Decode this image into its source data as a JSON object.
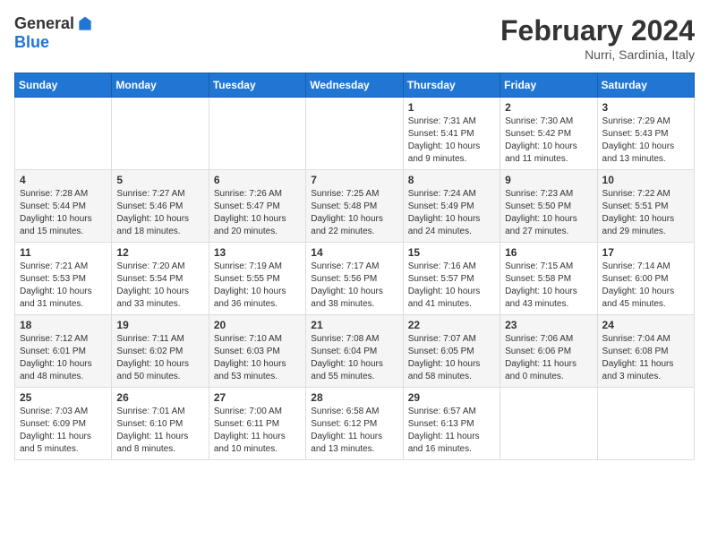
{
  "header": {
    "logo_general": "General",
    "logo_blue": "Blue",
    "month_year": "February 2024",
    "location": "Nurri, Sardinia, Italy"
  },
  "calendar": {
    "weekdays": [
      "Sunday",
      "Monday",
      "Tuesday",
      "Wednesday",
      "Thursday",
      "Friday",
      "Saturday"
    ],
    "weeks": [
      [
        {
          "day": "",
          "info": ""
        },
        {
          "day": "",
          "info": ""
        },
        {
          "day": "",
          "info": ""
        },
        {
          "day": "",
          "info": ""
        },
        {
          "day": "1",
          "info": "Sunrise: 7:31 AM\nSunset: 5:41 PM\nDaylight: 10 hours\nand 9 minutes."
        },
        {
          "day": "2",
          "info": "Sunrise: 7:30 AM\nSunset: 5:42 PM\nDaylight: 10 hours\nand 11 minutes."
        },
        {
          "day": "3",
          "info": "Sunrise: 7:29 AM\nSunset: 5:43 PM\nDaylight: 10 hours\nand 13 minutes."
        }
      ],
      [
        {
          "day": "4",
          "info": "Sunrise: 7:28 AM\nSunset: 5:44 PM\nDaylight: 10 hours\nand 15 minutes."
        },
        {
          "day": "5",
          "info": "Sunrise: 7:27 AM\nSunset: 5:46 PM\nDaylight: 10 hours\nand 18 minutes."
        },
        {
          "day": "6",
          "info": "Sunrise: 7:26 AM\nSunset: 5:47 PM\nDaylight: 10 hours\nand 20 minutes."
        },
        {
          "day": "7",
          "info": "Sunrise: 7:25 AM\nSunset: 5:48 PM\nDaylight: 10 hours\nand 22 minutes."
        },
        {
          "day": "8",
          "info": "Sunrise: 7:24 AM\nSunset: 5:49 PM\nDaylight: 10 hours\nand 24 minutes."
        },
        {
          "day": "9",
          "info": "Sunrise: 7:23 AM\nSunset: 5:50 PM\nDaylight: 10 hours\nand 27 minutes."
        },
        {
          "day": "10",
          "info": "Sunrise: 7:22 AM\nSunset: 5:51 PM\nDaylight: 10 hours\nand 29 minutes."
        }
      ],
      [
        {
          "day": "11",
          "info": "Sunrise: 7:21 AM\nSunset: 5:53 PM\nDaylight: 10 hours\nand 31 minutes."
        },
        {
          "day": "12",
          "info": "Sunrise: 7:20 AM\nSunset: 5:54 PM\nDaylight: 10 hours\nand 33 minutes."
        },
        {
          "day": "13",
          "info": "Sunrise: 7:19 AM\nSunset: 5:55 PM\nDaylight: 10 hours\nand 36 minutes."
        },
        {
          "day": "14",
          "info": "Sunrise: 7:17 AM\nSunset: 5:56 PM\nDaylight: 10 hours\nand 38 minutes."
        },
        {
          "day": "15",
          "info": "Sunrise: 7:16 AM\nSunset: 5:57 PM\nDaylight: 10 hours\nand 41 minutes."
        },
        {
          "day": "16",
          "info": "Sunrise: 7:15 AM\nSunset: 5:58 PM\nDaylight: 10 hours\nand 43 minutes."
        },
        {
          "day": "17",
          "info": "Sunrise: 7:14 AM\nSunset: 6:00 PM\nDaylight: 10 hours\nand 45 minutes."
        }
      ],
      [
        {
          "day": "18",
          "info": "Sunrise: 7:12 AM\nSunset: 6:01 PM\nDaylight: 10 hours\nand 48 minutes."
        },
        {
          "day": "19",
          "info": "Sunrise: 7:11 AM\nSunset: 6:02 PM\nDaylight: 10 hours\nand 50 minutes."
        },
        {
          "day": "20",
          "info": "Sunrise: 7:10 AM\nSunset: 6:03 PM\nDaylight: 10 hours\nand 53 minutes."
        },
        {
          "day": "21",
          "info": "Sunrise: 7:08 AM\nSunset: 6:04 PM\nDaylight: 10 hours\nand 55 minutes."
        },
        {
          "day": "22",
          "info": "Sunrise: 7:07 AM\nSunset: 6:05 PM\nDaylight: 10 hours\nand 58 minutes."
        },
        {
          "day": "23",
          "info": "Sunrise: 7:06 AM\nSunset: 6:06 PM\nDaylight: 11 hours\nand 0 minutes."
        },
        {
          "day": "24",
          "info": "Sunrise: 7:04 AM\nSunset: 6:08 PM\nDaylight: 11 hours\nand 3 minutes."
        }
      ],
      [
        {
          "day": "25",
          "info": "Sunrise: 7:03 AM\nSunset: 6:09 PM\nDaylight: 11 hours\nand 5 minutes."
        },
        {
          "day": "26",
          "info": "Sunrise: 7:01 AM\nSunset: 6:10 PM\nDaylight: 11 hours\nand 8 minutes."
        },
        {
          "day": "27",
          "info": "Sunrise: 7:00 AM\nSunset: 6:11 PM\nDaylight: 11 hours\nand 10 minutes."
        },
        {
          "day": "28",
          "info": "Sunrise: 6:58 AM\nSunset: 6:12 PM\nDaylight: 11 hours\nand 13 minutes."
        },
        {
          "day": "29",
          "info": "Sunrise: 6:57 AM\nSunset: 6:13 PM\nDaylight: 11 hours\nand 16 minutes."
        },
        {
          "day": "",
          "info": ""
        },
        {
          "day": "",
          "info": ""
        }
      ]
    ]
  }
}
